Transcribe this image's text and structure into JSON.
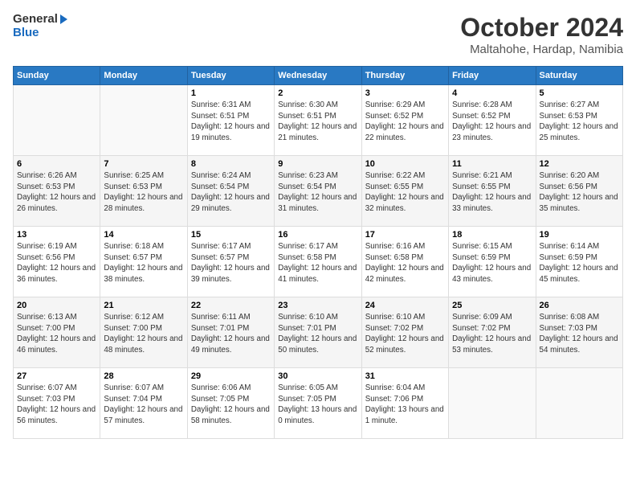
{
  "header": {
    "logo_line1": "General",
    "logo_line2": "Blue",
    "month_year": "October 2024",
    "location": "Maltahohe, Hardap, Namibia"
  },
  "weekdays": [
    "Sunday",
    "Monday",
    "Tuesday",
    "Wednesday",
    "Thursday",
    "Friday",
    "Saturday"
  ],
  "weeks": [
    [
      {
        "day": "",
        "sunrise": "",
        "sunset": "",
        "daylight": ""
      },
      {
        "day": "",
        "sunrise": "",
        "sunset": "",
        "daylight": ""
      },
      {
        "day": "1",
        "sunrise": "Sunrise: 6:31 AM",
        "sunset": "Sunset: 6:51 PM",
        "daylight": "Daylight: 12 hours and 19 minutes."
      },
      {
        "day": "2",
        "sunrise": "Sunrise: 6:30 AM",
        "sunset": "Sunset: 6:51 PM",
        "daylight": "Daylight: 12 hours and 21 minutes."
      },
      {
        "day": "3",
        "sunrise": "Sunrise: 6:29 AM",
        "sunset": "Sunset: 6:52 PM",
        "daylight": "Daylight: 12 hours and 22 minutes."
      },
      {
        "day": "4",
        "sunrise": "Sunrise: 6:28 AM",
        "sunset": "Sunset: 6:52 PM",
        "daylight": "Daylight: 12 hours and 23 minutes."
      },
      {
        "day": "5",
        "sunrise": "Sunrise: 6:27 AM",
        "sunset": "Sunset: 6:53 PM",
        "daylight": "Daylight: 12 hours and 25 minutes."
      }
    ],
    [
      {
        "day": "6",
        "sunrise": "Sunrise: 6:26 AM",
        "sunset": "Sunset: 6:53 PM",
        "daylight": "Daylight: 12 hours and 26 minutes."
      },
      {
        "day": "7",
        "sunrise": "Sunrise: 6:25 AM",
        "sunset": "Sunset: 6:53 PM",
        "daylight": "Daylight: 12 hours and 28 minutes."
      },
      {
        "day": "8",
        "sunrise": "Sunrise: 6:24 AM",
        "sunset": "Sunset: 6:54 PM",
        "daylight": "Daylight: 12 hours and 29 minutes."
      },
      {
        "day": "9",
        "sunrise": "Sunrise: 6:23 AM",
        "sunset": "Sunset: 6:54 PM",
        "daylight": "Daylight: 12 hours and 31 minutes."
      },
      {
        "day": "10",
        "sunrise": "Sunrise: 6:22 AM",
        "sunset": "Sunset: 6:55 PM",
        "daylight": "Daylight: 12 hours and 32 minutes."
      },
      {
        "day": "11",
        "sunrise": "Sunrise: 6:21 AM",
        "sunset": "Sunset: 6:55 PM",
        "daylight": "Daylight: 12 hours and 33 minutes."
      },
      {
        "day": "12",
        "sunrise": "Sunrise: 6:20 AM",
        "sunset": "Sunset: 6:56 PM",
        "daylight": "Daylight: 12 hours and 35 minutes."
      }
    ],
    [
      {
        "day": "13",
        "sunrise": "Sunrise: 6:19 AM",
        "sunset": "Sunset: 6:56 PM",
        "daylight": "Daylight: 12 hours and 36 minutes."
      },
      {
        "day": "14",
        "sunrise": "Sunrise: 6:18 AM",
        "sunset": "Sunset: 6:57 PM",
        "daylight": "Daylight: 12 hours and 38 minutes."
      },
      {
        "day": "15",
        "sunrise": "Sunrise: 6:17 AM",
        "sunset": "Sunset: 6:57 PM",
        "daylight": "Daylight: 12 hours and 39 minutes."
      },
      {
        "day": "16",
        "sunrise": "Sunrise: 6:17 AM",
        "sunset": "Sunset: 6:58 PM",
        "daylight": "Daylight: 12 hours and 41 minutes."
      },
      {
        "day": "17",
        "sunrise": "Sunrise: 6:16 AM",
        "sunset": "Sunset: 6:58 PM",
        "daylight": "Daylight: 12 hours and 42 minutes."
      },
      {
        "day": "18",
        "sunrise": "Sunrise: 6:15 AM",
        "sunset": "Sunset: 6:59 PM",
        "daylight": "Daylight: 12 hours and 43 minutes."
      },
      {
        "day": "19",
        "sunrise": "Sunrise: 6:14 AM",
        "sunset": "Sunset: 6:59 PM",
        "daylight": "Daylight: 12 hours and 45 minutes."
      }
    ],
    [
      {
        "day": "20",
        "sunrise": "Sunrise: 6:13 AM",
        "sunset": "Sunset: 7:00 PM",
        "daylight": "Daylight: 12 hours and 46 minutes."
      },
      {
        "day": "21",
        "sunrise": "Sunrise: 6:12 AM",
        "sunset": "Sunset: 7:00 PM",
        "daylight": "Daylight: 12 hours and 48 minutes."
      },
      {
        "day": "22",
        "sunrise": "Sunrise: 6:11 AM",
        "sunset": "Sunset: 7:01 PM",
        "daylight": "Daylight: 12 hours and 49 minutes."
      },
      {
        "day": "23",
        "sunrise": "Sunrise: 6:10 AM",
        "sunset": "Sunset: 7:01 PM",
        "daylight": "Daylight: 12 hours and 50 minutes."
      },
      {
        "day": "24",
        "sunrise": "Sunrise: 6:10 AM",
        "sunset": "Sunset: 7:02 PM",
        "daylight": "Daylight: 12 hours and 52 minutes."
      },
      {
        "day": "25",
        "sunrise": "Sunrise: 6:09 AM",
        "sunset": "Sunset: 7:02 PM",
        "daylight": "Daylight: 12 hours and 53 minutes."
      },
      {
        "day": "26",
        "sunrise": "Sunrise: 6:08 AM",
        "sunset": "Sunset: 7:03 PM",
        "daylight": "Daylight: 12 hours and 54 minutes."
      }
    ],
    [
      {
        "day": "27",
        "sunrise": "Sunrise: 6:07 AM",
        "sunset": "Sunset: 7:03 PM",
        "daylight": "Daylight: 12 hours and 56 minutes."
      },
      {
        "day": "28",
        "sunrise": "Sunrise: 6:07 AM",
        "sunset": "Sunset: 7:04 PM",
        "daylight": "Daylight: 12 hours and 57 minutes."
      },
      {
        "day": "29",
        "sunrise": "Sunrise: 6:06 AM",
        "sunset": "Sunset: 7:05 PM",
        "daylight": "Daylight: 12 hours and 58 minutes."
      },
      {
        "day": "30",
        "sunrise": "Sunrise: 6:05 AM",
        "sunset": "Sunset: 7:05 PM",
        "daylight": "Daylight: 13 hours and 0 minutes."
      },
      {
        "day": "31",
        "sunrise": "Sunrise: 6:04 AM",
        "sunset": "Sunset: 7:06 PM",
        "daylight": "Daylight: 13 hours and 1 minute."
      },
      {
        "day": "",
        "sunrise": "",
        "sunset": "",
        "daylight": ""
      },
      {
        "day": "",
        "sunrise": "",
        "sunset": "",
        "daylight": ""
      }
    ]
  ]
}
